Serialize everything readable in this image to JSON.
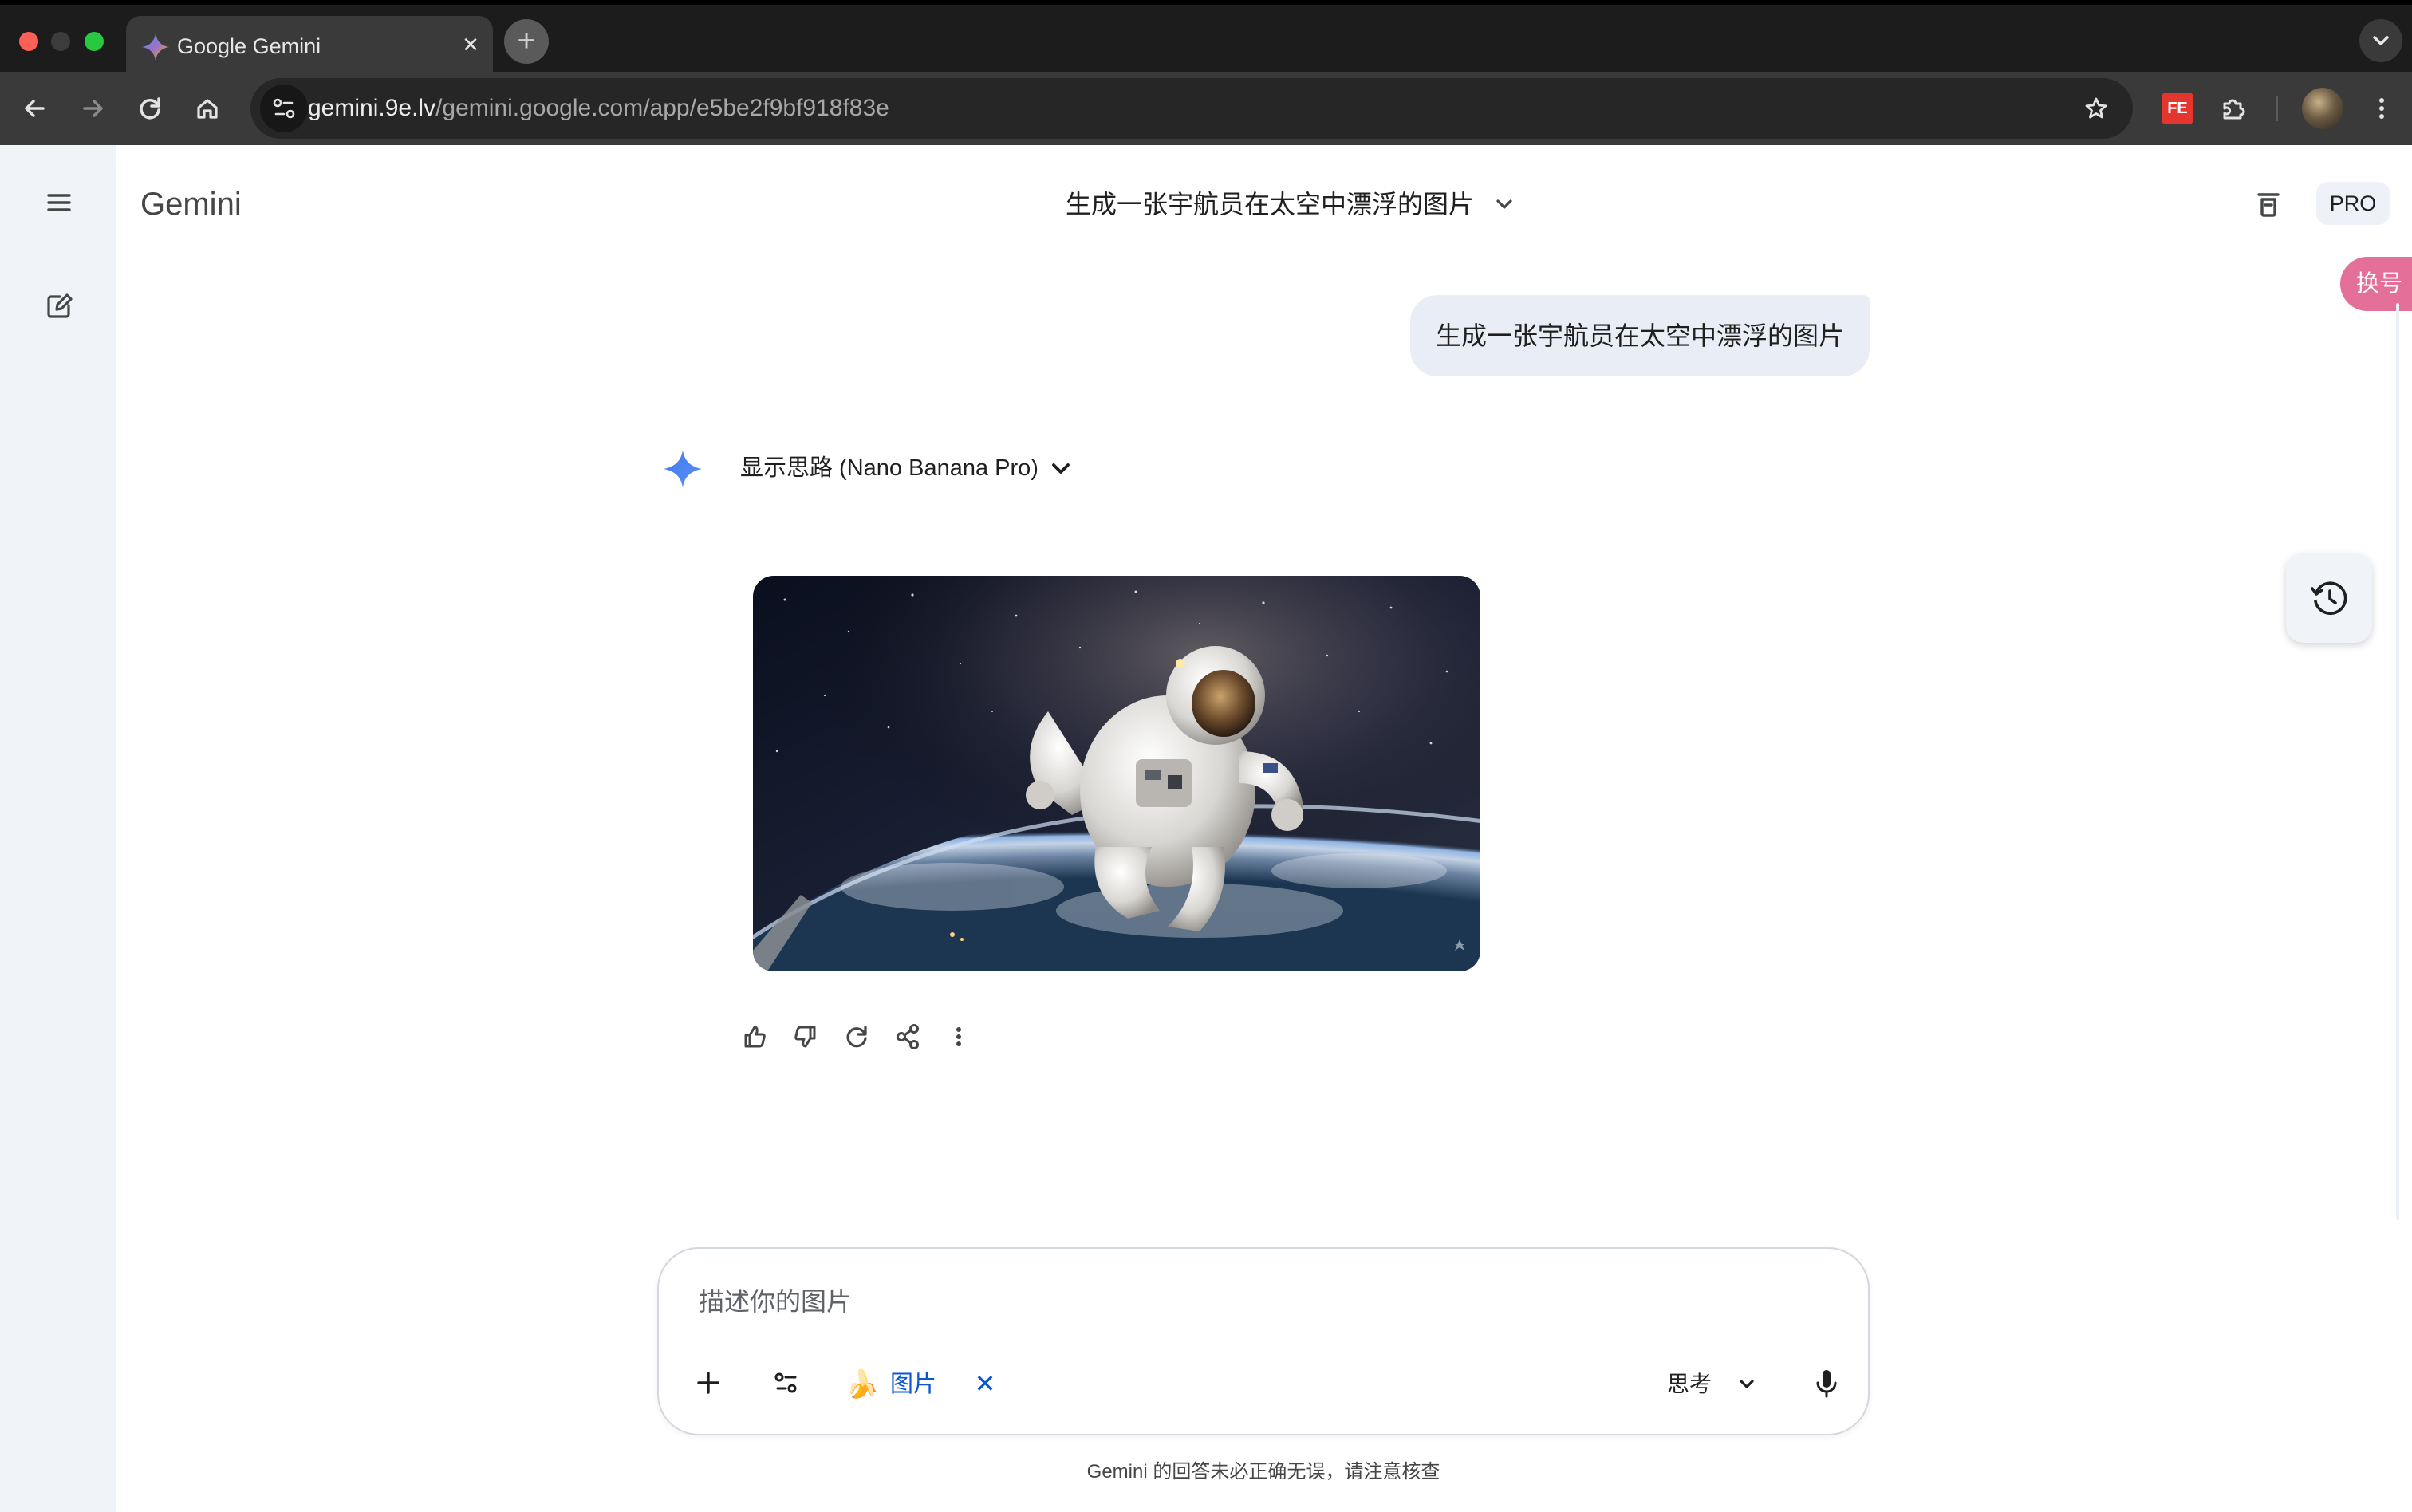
{
  "browser": {
    "tab_title": "Google Gemini",
    "url_host": "gemini.9e.lv",
    "url_path": "/gemini.google.com/app/e5be2f9bf918f83e",
    "extension_badge": "FE"
  },
  "app": {
    "brand": "Gemini",
    "conversation_title": "生成一张宇航员在太空中漂浮的图片",
    "plan_badge": "PRO",
    "account_switch_label": "换号"
  },
  "chat": {
    "user_message": "生成一张宇航员在太空中漂浮的图片",
    "thinking_toggle_label": "显示思路 (Nano Banana Pro)"
  },
  "composer": {
    "placeholder": "描述你的图片",
    "tool_chip_label": "图片",
    "tool_chip_icon": "🍌",
    "mode_label": "思考"
  },
  "footer": {
    "disclaimer": "Gemini 的回答未必正确无误，请注意核查"
  },
  "colors": {
    "accent_blue": "#0b57d0",
    "rail_bg": "#f0f4f9",
    "user_bubble_bg": "#e9eef6",
    "account_switch_bg": "#e46f98",
    "chrome_dark": "#1c1c1c"
  }
}
